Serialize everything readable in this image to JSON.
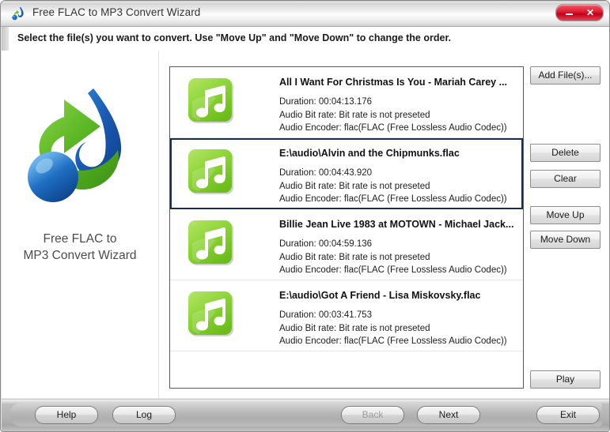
{
  "window": {
    "title": "Free FLAC to MP3 Convert Wizard",
    "app_icon": "app-logo-icon",
    "minimize_label": "",
    "close_label": "✕",
    "accent_close_color": "#d71a2e",
    "selection_border_color": "#172d52"
  },
  "instruction": {
    "text": "Select the file(s) you want to convert. Use \"Move Up\" and \"Move Down\" to change the order."
  },
  "branding": {
    "logo_icon": "music-note-convert-logo-icon",
    "line1": "Free FLAC to",
    "line2": "MP3 Convert Wizard"
  },
  "file_list": {
    "items": [
      {
        "icon": "music-note-file-icon",
        "title": "All I Want For Christmas Is You - Mariah Carey ...",
        "duration": "Duration: 00:04:13.176",
        "bitrate": "Audio Bit rate: Bit rate is not preseted",
        "encoder": "Audio Encoder: flac(FLAC (Free Lossless Audio Codec))",
        "selected": false
      },
      {
        "icon": "music-note-file-icon",
        "title": "E:\\audio\\Alvin and the Chipmunks.flac",
        "duration": "Duration: 00:04:43.920",
        "bitrate": "Audio Bit rate: Bit rate is not preseted",
        "encoder": "Audio Encoder: flac(FLAC (Free Lossless Audio Codec))",
        "selected": true
      },
      {
        "icon": "music-note-file-icon",
        "title": "Billie Jean Live 1983 at MOTOWN - Michael Jack...",
        "duration": "Duration: 00:04:59.136",
        "bitrate": "Audio Bit rate: Bit rate is not preseted",
        "encoder": "Audio Encoder: flac(FLAC (Free Lossless Audio Codec))",
        "selected": false
      },
      {
        "icon": "music-note-file-icon",
        "title": "E:\\audio\\Got A Friend - Lisa Miskovsky.flac",
        "duration": "Duration: 00:03:41.753",
        "bitrate": "Audio Bit rate: Bit rate is not preseted",
        "encoder": "Audio Encoder: flac(FLAC (Free Lossless Audio Codec))",
        "selected": false
      }
    ]
  },
  "side_buttons": {
    "add_files": "Add File(s)...",
    "delete": "Delete",
    "clear": "Clear",
    "move_up": "Move Up",
    "move_down": "Move Down",
    "play": "Play"
  },
  "bottom_buttons": {
    "help": "Help",
    "log": "Log",
    "back": "Back",
    "back_disabled": true,
    "next": "Next",
    "exit": "Exit"
  }
}
